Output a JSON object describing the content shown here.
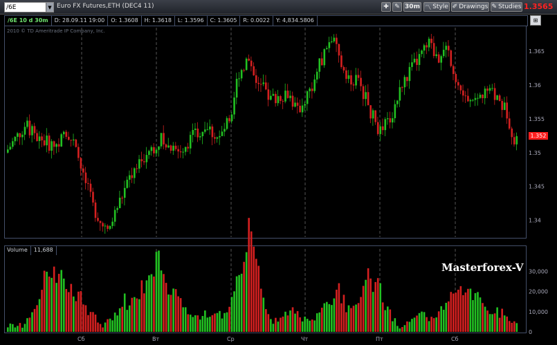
{
  "toolbar": {
    "symbol": "/6E",
    "description": "Euro FX Futures,ETH (DEC4 11)",
    "timeframe": "30m",
    "style_label": "Style",
    "drawings_label": "Drawings",
    "studies_label": "Studies",
    "last_price": "1.3565"
  },
  "info": {
    "aggregation": "/6E 10 d 30m",
    "date": "D: 28.09.11 19:00",
    "open": "O: 1.3608",
    "high": "H: 1.3618",
    "low": "L: 1.3596",
    "close": "C: 1.3605",
    "range": "R: 0.0022",
    "volume": "Y: 4,834.5806"
  },
  "copyright": "2010 © TD Ameritrade IP Company, Inc.",
  "price_marker": "1.352",
  "volume_panel": {
    "label": "Volume",
    "value": "11,688"
  },
  "watermark": "Masterforex-V",
  "colors": {
    "up": "#22c022",
    "down": "#d42020",
    "grid": "#8a8a8a",
    "price": "#ff2222"
  },
  "chart_data": {
    "type": "candlestick",
    "price_ticks": [
      "1.365",
      "1.36",
      "1.355",
      "1.35",
      "1.345",
      "1.34"
    ],
    "price_tick_values": [
      1.365,
      1.36,
      1.355,
      1.35,
      1.345,
      1.34
    ],
    "ylim": [
      1.3375,
      1.3685
    ],
    "volume_ticks": [
      "30,000",
      "20,000",
      "10,000",
      "0"
    ],
    "volume_tick_values": [
      30000,
      20000,
      10000,
      0
    ],
    "volume_max": 37000,
    "day_labels": [
      "Сб",
      "Вт",
      "Ср",
      "Чт",
      "Пт",
      "Сб"
    ],
    "trend_waypoints": [
      [
        0,
        1.35
      ],
      [
        8,
        1.354
      ],
      [
        14,
        1.352
      ],
      [
        20,
        1.351
      ],
      [
        26,
        1.353
      ],
      [
        30,
        1.349
      ],
      [
        36,
        1.342
      ],
      [
        42,
        1.338
      ],
      [
        46,
        1.342
      ],
      [
        52,
        1.347
      ],
      [
        58,
        1.35
      ],
      [
        64,
        1.352
      ],
      [
        70,
        1.35
      ],
      [
        76,
        1.352
      ],
      [
        82,
        1.354
      ],
      [
        88,
        1.352
      ],
      [
        92,
        1.355
      ],
      [
        96,
        1.362
      ],
      [
        100,
        1.364
      ],
      [
        104,
        1.36
      ],
      [
        110,
        1.358
      ],
      [
        116,
        1.359
      ],
      [
        120,
        1.356
      ],
      [
        126,
        1.36
      ],
      [
        130,
        1.364
      ],
      [
        134,
        1.367
      ],
      [
        138,
        1.363
      ],
      [
        142,
        1.361
      ],
      [
        146,
        1.36
      ],
      [
        150,
        1.356
      ],
      [
        154,
        1.353
      ],
      [
        158,
        1.355
      ],
      [
        162,
        1.359
      ],
      [
        166,
        1.362
      ],
      [
        170,
        1.364
      ],
      [
        174,
        1.366
      ],
      [
        178,
        1.364
      ],
      [
        182,
        1.365
      ],
      [
        186,
        1.36
      ],
      [
        190,
        1.357
      ],
      [
        194,
        1.358
      ],
      [
        198,
        1.359
      ],
      [
        202,
        1.358
      ],
      [
        206,
        1.356
      ],
      [
        209,
        1.352
      ]
    ],
    "candle_count": 210,
    "volume_peaks": [
      [
        15,
        23000
      ],
      [
        22,
        30000
      ],
      [
        30,
        14000
      ],
      [
        48,
        16000
      ],
      [
        58,
        22000
      ],
      [
        62,
        24000
      ],
      [
        70,
        18000
      ],
      [
        84,
        12000
      ],
      [
        98,
        32000
      ],
      [
        100,
        28000
      ],
      [
        116,
        10000
      ],
      [
        130,
        8000
      ],
      [
        136,
        18000
      ],
      [
        148,
        21000
      ],
      [
        152,
        15000
      ],
      [
        170,
        9000
      ],
      [
        182,
        17000
      ],
      [
        190,
        19000
      ],
      [
        198,
        10000
      ],
      [
        206,
        4000
      ]
    ]
  }
}
